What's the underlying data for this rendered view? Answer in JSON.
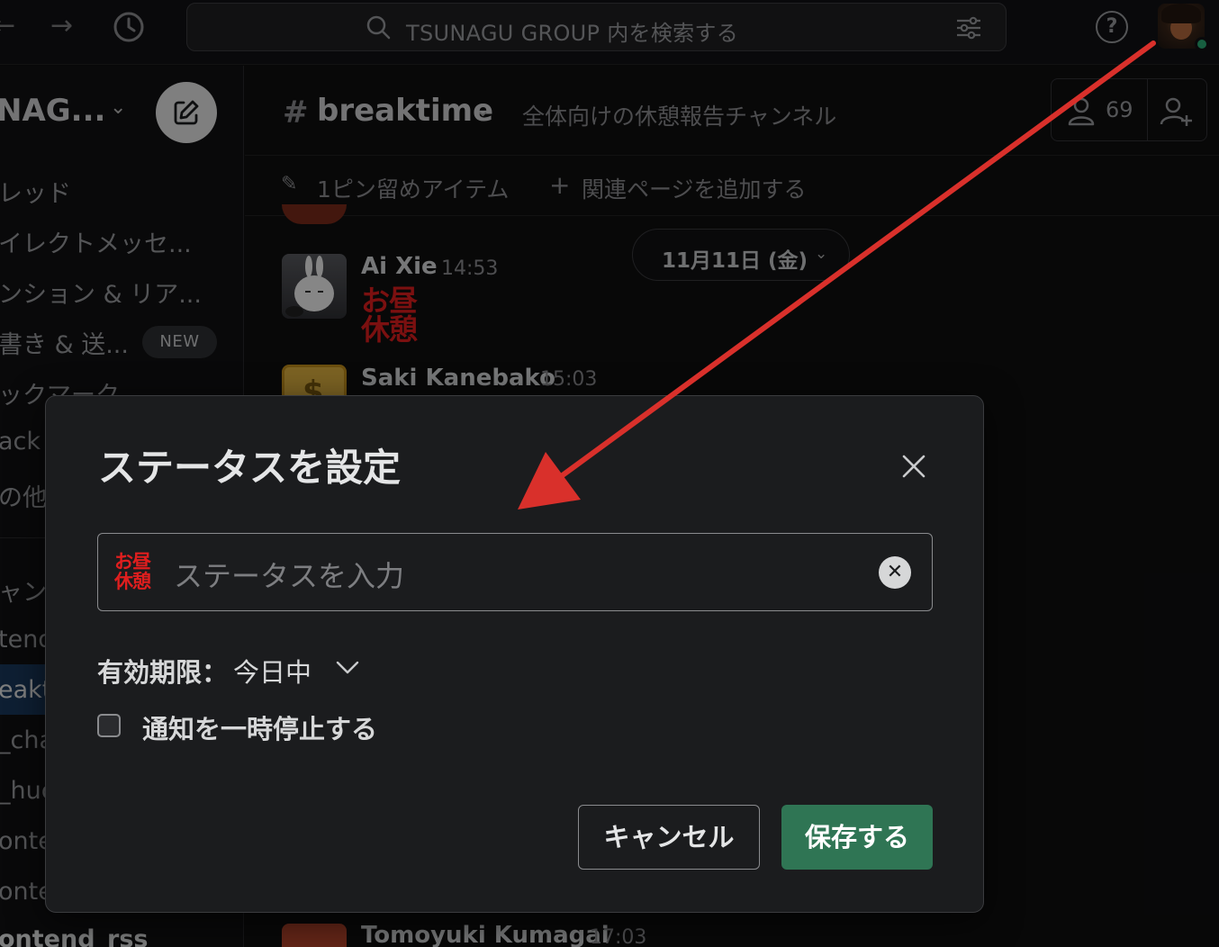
{
  "topbar": {
    "search_placeholder": "TSUNAGU GROUP 内を検索する",
    "back_icon": "arrow-left-icon",
    "forward_icon": "arrow-right-icon",
    "history_icon": "clock-icon",
    "help_icon": "question-circle-icon",
    "help_glyph": "?"
  },
  "sidebar": {
    "workspace_name": "NAG...",
    "workspace_chevron": "⌄",
    "items": [
      {
        "label": "レッド"
      },
      {
        "label": "イレクトメッセ..."
      },
      {
        "label": "ンション & リア..."
      },
      {
        "label": "書き & 送..."
      },
      {
        "label": "ックマーク"
      },
      {
        "label": "ack"
      },
      {
        "label": "の他"
      }
    ],
    "new_badge": "NEW",
    "channels": [
      {
        "label": "ャン"
      },
      {
        "label": "tend"
      },
      {
        "label": "eakt"
      },
      {
        "label": "_cha"
      },
      {
        "label": "_huc"
      },
      {
        "label": "onte"
      },
      {
        "label": "onte"
      },
      {
        "label": "ontend_rss"
      }
    ]
  },
  "channel": {
    "hash": "#",
    "name": "breaktime",
    "chevron": "⌄",
    "description": "全体向けの休憩報告チャンネル",
    "member_count": "69",
    "pinned": "1ピン留めアイテム",
    "add_bookmark_plus": "+",
    "add_bookmark": "関連ページを追加する"
  },
  "messages": {
    "date_pill": "11月11日 (金)",
    "date_chevron": "⌄",
    "items": [
      {
        "name": "Ai Xie",
        "time": "14:53",
        "status_line1": "お昼",
        "status_line2": "休憩"
      },
      {
        "name": "Saki Kanebako",
        "time": "15:03"
      },
      {
        "name": "Tomoyuki Kumagai",
        "time": "17:03"
      }
    ]
  },
  "modal": {
    "title": "ステータスを設定",
    "status_emoji_line1": "お昼",
    "status_emoji_line2": "休憩",
    "status_placeholder": "ステータスを入力",
    "clear_glyph": "✕",
    "expiry_label": "有効期限：",
    "expiry_value": "今日中",
    "pause_notifications": "通知を一時停止する",
    "pause_checked": false,
    "cancel": "キャンセル",
    "save": "保存する"
  },
  "colors": {
    "accent_save": "#2f7554",
    "status_red": "#e01e1e",
    "presence_green": "#2bac76",
    "annotation_arrow": "#d9302b"
  }
}
